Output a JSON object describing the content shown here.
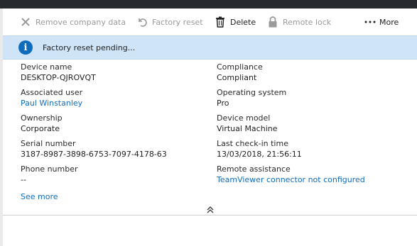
{
  "toolbar": {
    "remove_company_data": "Remove company data",
    "factory_reset": "Factory reset",
    "delete": "Delete",
    "remote_lock": "Remote lock",
    "more": "More"
  },
  "banner": {
    "message": "Factory reset pending..."
  },
  "details": {
    "device_name_label": "Device name",
    "device_name_value": "DESKTOP-QJROVQT",
    "associated_user_label": "Associated user",
    "associated_user_value": "Paul Winstanley",
    "ownership_label": "Ownership",
    "ownership_value": "Corporate",
    "serial_label": "Serial number",
    "serial_value": "3187-8987-3898-6753-7097-4178-63",
    "phone_label": "Phone number",
    "phone_value": "--",
    "compliance_label": "Compliance",
    "compliance_value": "Compliant",
    "os_label": "Operating system",
    "os_value": "Pro",
    "model_label": "Device model",
    "model_value": "Virtual Machine",
    "checkin_label": "Last check-in time",
    "checkin_value": "13/03/2018, 21:56:11",
    "remote_label": "Remote assistance",
    "remote_value": "TeamViewer connector not configured"
  },
  "see_more": "See more",
  "colors": {
    "link": "#0f6cbd",
    "banner": "#cfe4f6",
    "topbar": "#26292d"
  }
}
